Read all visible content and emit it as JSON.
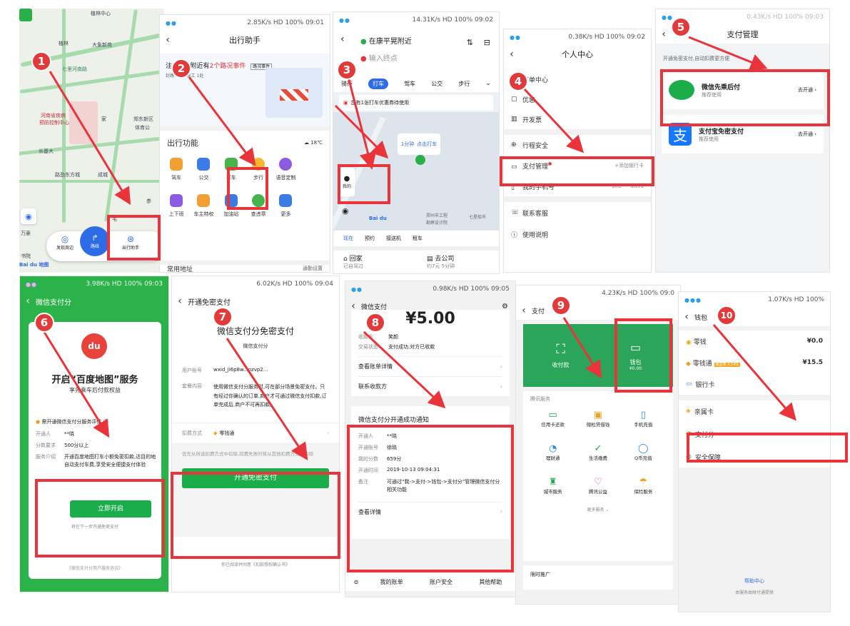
{
  "colors": {
    "accent_red": "#e8343a",
    "wechat_green": "#1aad4a",
    "baidu_blue": "#2e6be6"
  },
  "steps": [
    "1",
    "2",
    "3",
    "4",
    "5",
    "6",
    "7",
    "8",
    "9",
    "10"
  ],
  "p1": {
    "map_labels": [
      "植林中心",
      "植林",
      "大象新苑",
      "七里河南路",
      "河南省疾病",
      "预防控制中心",
      "家",
      "郑东新区",
      "体育公",
      "长基大",
      "路劲东方城",
      "成城",
      "参",
      "万豪",
      "书院",
      "宅"
    ],
    "btn_discover": "发现周边",
    "btn_route": "路线",
    "btn_assistant": "出行助手",
    "logo": "Bai du 地图"
  },
  "p2": {
    "status": "2.85K/s HD 100% 09:01",
    "title": "出行助手",
    "notice_prefix": "注意哦~附近有",
    "notice_highlight": "2个路况事件",
    "notice_tag": "路况事件",
    "notice_sub": "封路 1处 | 施工 1处",
    "section_title": "出行功能",
    "weather": "18℃",
    "functions": [
      "驾车",
      "公交",
      "打车",
      "步行",
      "语音定制",
      "上下班",
      "车主特权",
      "加油站",
      "查违章",
      "更多"
    ],
    "bottom_left": "常用地址",
    "bottom_right": "通勤设置"
  },
  "p3": {
    "status": "14.31K/s HD 100% 09:02",
    "from": "在康平晃附近",
    "to": "输入终点",
    "tabs": [
      "骑行",
      "打车",
      "驾车",
      "公交",
      "步行"
    ],
    "coupon": "您有1张打车优惠券待使用",
    "pickup": "点击打车",
    "pickup_eta": "1分钟",
    "mine": "我的",
    "sub_tabs": [
      "现在",
      "预约",
      "接送机",
      "租车"
    ],
    "home": "回家",
    "home_sub": "已自驾过",
    "company": "去公司",
    "company_sub": "约7元 5分钟",
    "map_labels": [
      "郑州市工程",
      "勘察设计院",
      "七星船市"
    ],
    "logo": "Bai du"
  },
  "p4": {
    "status": "0.38K/s HD 100% 09:02",
    "title": "个人中心",
    "items": [
      "订单中心",
      "优惠",
      "开发票",
      "行程安全",
      "支付管理",
      "我的手机号",
      "联系客服",
      "使用说明"
    ],
    "pay_hint": "+添加银行卡",
    "phone": "183****2851"
  },
  "p5": {
    "status": "0.43K/s HD 100% 09:03",
    "title": "支付管理",
    "note": "开通免密支付,自动扣费更方便",
    "wechat_title": "微信先乘后付",
    "wechat_sub": "推荐使用",
    "wechat_action": "去开通",
    "alipay_title": "支付宝免密支付",
    "alipay_sub": "推荐使用",
    "alipay_action": "去开通"
  },
  "p6": {
    "status": "3.98K/s HD 100% 09:03",
    "title": "微信支付分",
    "brand": "du",
    "headline": "开启“百度地图”服务",
    "sub": "享先乘车后付款权益",
    "eval": "需开通微信支付分服务评估",
    "rows": [
      {
        "k": "开通人",
        "v": "**晓"
      },
      {
        "k": "分数要求",
        "v": "500分以上"
      },
      {
        "k": "服务介绍",
        "v": "开通百度地图打车小额免密扣款,达目的地自动支付车费,享受安全便捷支付体验"
      }
    ],
    "button": "立即开启",
    "next": "将在下一步开通免密支付",
    "footer": "《微信支付分用户服务协议》"
  },
  "p7": {
    "status": "6.02K/s HD 100% 09:04",
    "title": "开通免密支付",
    "headline": "微信支付分免密支付",
    "sub": "微信支付分",
    "account_k": "用户账号",
    "account_v": "wxid_ji6p8w...ozvp2...",
    "content_k": "套餐内容",
    "content_v": "使用微信支付分服务时,可在部分场景免密支付。只有经过你确认的订单,商户才可通过微信支付扣款,订单完成后,商户不可再扣款。",
    "method_k": "扣费方式",
    "method_v": "零钱通",
    "priority": "优先从所选扣费方式中扣除,扣费失败时将从其他扣费方式中扣除",
    "button": "开通免密支付",
    "footer": "你已阅读并同意《扣款授权确认书》"
  },
  "p8": {
    "status": "0.98K/s HD 100% 09:05",
    "title": "微信支付",
    "amount": "¥5.00",
    "payee_k": "收款方",
    "payee_v": "笑颜",
    "state_k": "交易状态",
    "state_v": "支付成功,对方已收款",
    "link1": "查看账单详情",
    "link2": "联系收款方",
    "notice_title": "微信支付分开通成功通知",
    "notice_rows": [
      {
        "k": "开通人",
        "v": "**晓"
      },
      {
        "k": "开通账号",
        "v": "徐晓"
      },
      {
        "k": "我的分数",
        "v": "659分"
      },
      {
        "k": "开通时间",
        "v": "2019-10-13 09:04:31"
      },
      {
        "k": "备注",
        "v": "可通过“我->支付->钱包->支付分”管理微信支付分相关功能"
      }
    ],
    "detail": "查看详情",
    "bottom": [
      "我的账单",
      "账户安全",
      "其他帮助"
    ]
  },
  "p9": {
    "status": "4.23K/s HD 100% 09:0",
    "title": "支付",
    "collect": "收付款",
    "wallet": "钱包",
    "wallet_amount": "¥0.00",
    "services_title": "腾讯服务",
    "services": [
      "信用卡还款",
      "微粒贷借钱",
      "手机充值",
      "理财通",
      "生活缴费",
      "Q币充值",
      "城市服务",
      "腾讯公益",
      "保险服务"
    ],
    "more": "更多服务",
    "promo": "限时推广"
  },
  "p10": {
    "status": "1.07K/s HD 100%",
    "title": "钱包",
    "items": [
      {
        "k": "零钱",
        "v": "¥0.0"
      },
      {
        "k": "零钱通",
        "v": "¥15.5"
      },
      {
        "k": "银行卡",
        "v": ""
      },
      {
        "k": "亲属卡",
        "v": ""
      },
      {
        "k": "支付分",
        "v": ""
      },
      {
        "k": "安全保障",
        "v": ""
      }
    ],
    "lqt_tag": "收益率 2.54%",
    "help": "帮助中心",
    "provider": "本服务由财付通提供"
  }
}
